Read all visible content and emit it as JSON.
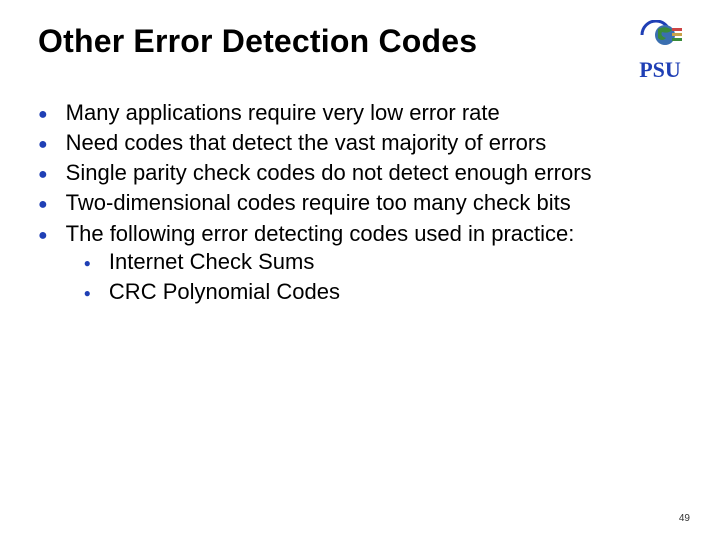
{
  "title": "Other Error Detection Codes",
  "logo": {
    "text": "PSU"
  },
  "bullets": {
    "b0": "Many applications require very low error rate",
    "b1": "Need codes that detect the vast majority of errors",
    "b2": "Single parity check codes do not detect enough errors",
    "b3": "Two-dimensional codes require too many check bits",
    "b4": "The following error detecting codes used in practice:",
    "s0": "Internet Check Sums",
    "s1": "CRC Polynomial Codes"
  },
  "page_number": "49"
}
